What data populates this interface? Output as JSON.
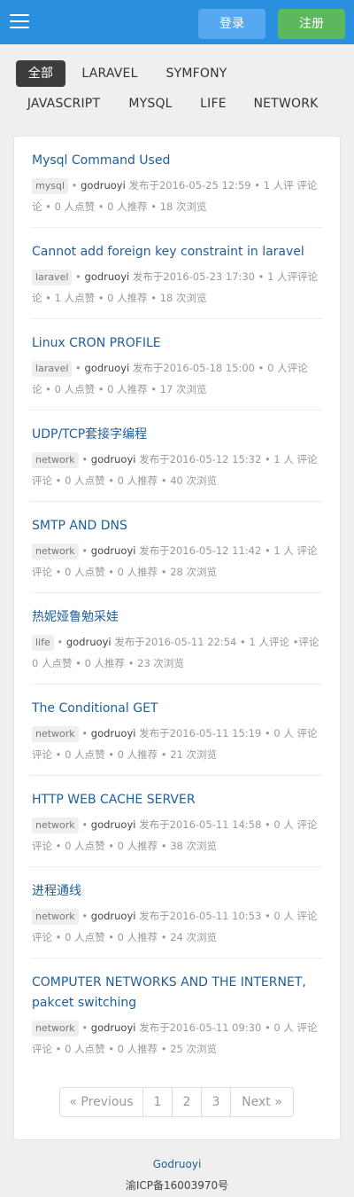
{
  "header": {
    "login_label": "登录",
    "register_label": "注册",
    "colors": {
      "bar": "#2b8fe0",
      "login": "#56a9f0",
      "register": "#5cb85c"
    }
  },
  "categories": [
    "全部",
    "LARAVEL",
    "SYMFONY",
    "JAVASCRIPT",
    "MYSQL",
    "LIFE",
    "NETWORK"
  ],
  "posts": [
    {
      "title": "Mysql Command Used",
      "tag": "mysql",
      "author": "godruoyi",
      "date_text": "发布于2016-05-25 12:59",
      "line1_rest": "• 1 人评 评论",
      "line2": "论 • 0 人点赞 • 0 人推荐 • 18 次浏览"
    },
    {
      "title": "Cannot add foreign key constraint in laravel",
      "tag": "laravel",
      "author": "godruoyi",
      "date_text": "发布于2016-05-23 17:30",
      "line1_rest": "• 1 人评评论",
      "line2": "论 • 1 人点赞 • 0 人推荐 • 18 次浏览"
    },
    {
      "title": "Linux CRON PROFILE",
      "tag": "laravel",
      "author": "godruoyi",
      "date_text": "发布于2016-05-18 15:00",
      "line1_rest": "• 0 人评论",
      "line2": "论 • 0 人点赞 • 0 人推荐 • 17 次浏览"
    },
    {
      "title": "UDP/TCP套接字编程",
      "tag": "network",
      "author": "godruoyi",
      "date_text": "发布于2016-05-12 15:32",
      "line1_rest": "• 1 人 评论",
      "line2": "评论 • 0 人点赞 • 0 人推荐 • 40 次浏览"
    },
    {
      "title": "SMTP AND DNS",
      "tag": "network",
      "author": "godruoyi",
      "date_text": "发布于2016-05-12 11:42",
      "line1_rest": "• 1 人 评论",
      "line2": "评论 • 0 人点赞 • 0 人推荐 • 28 次浏览"
    },
    {
      "title": "热妮娅鲁勉采娃",
      "tag": "life",
      "author": "godruoyi",
      "date_text": "发布于2016-05-11 22:54",
      "line1_rest": "• 1 人评论 •评论",
      "line2": "0 人点赞 • 0 人推荐 • 23 次浏览"
    },
    {
      "title": "The Conditional GET",
      "tag": "network",
      "author": "godruoyi",
      "date_text": "发布于2016-05-11 15:19",
      "line1_rest": "• 0 人 评论",
      "line2": "评论 • 0 人点赞 • 0 人推荐 • 21 次浏览"
    },
    {
      "title": "HTTP WEB CACHE SERVER",
      "tag": "network",
      "author": "godruoyi",
      "date_text": "发布于2016-05-11 14:58",
      "line1_rest": "• 0 人 评论",
      "line2": "评论 • 0 人点赞 • 0 人推荐 • 38 次浏览"
    },
    {
      "title": "进程通线",
      "tag": "network",
      "author": "godruoyi",
      "date_text": "发布于2016-05-11 10:53",
      "line1_rest": "• 0 人 评论",
      "line2": "评论 • 0 人点赞 • 0 人推荐 • 24 次浏览"
    },
    {
      "title": "COMPUTER NETWORKS AND THE INTERNET, pakcet switching",
      "tag": "network",
      "author": "godruoyi",
      "date_text": "发布于2016-05-11 09:30",
      "line1_rest": "• 0 人 评论",
      "line2": "评论 • 0 人点赞 • 0 人推荐 • 25 次浏览"
    }
  ],
  "pagination": {
    "prev": "« Previous",
    "pages": [
      "1",
      "2",
      "3"
    ],
    "next": "Next »"
  },
  "footer": {
    "name": "Godruoyi",
    "icp": "渝ICP备16003970号"
  }
}
